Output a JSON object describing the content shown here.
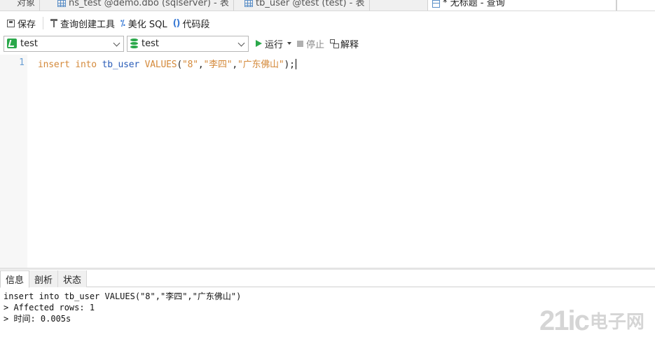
{
  "tabs": [
    {
      "label": "对象",
      "type": "plain"
    },
    {
      "label": "ns_test @demo.dbo (sqlserver) - 表",
      "type": "table"
    },
    {
      "label": "tb_user @test (test) - 表",
      "type": "table"
    },
    {
      "label": "* 无标题 - 查询",
      "type": "query",
      "active": true
    }
  ],
  "toolbar": {
    "save_label": "保存",
    "query_builder_label": "查询创建工具",
    "beautify_label": "美化 SQL",
    "snippet_label": "代码段"
  },
  "connection": {
    "value": "test"
  },
  "database": {
    "value": "test"
  },
  "run": {
    "run_label": "运行",
    "stop_label": "停止",
    "explain_label": "解释"
  },
  "editor": {
    "line_number": "1",
    "tokens": {
      "k1": "insert",
      "k2": "into",
      "table": "tb_user",
      "k3": "VALUES",
      "open": "(",
      "v1": "\"8\"",
      "c1": ",",
      "v2": "\"李四\"",
      "c2": ",",
      "v3": "\"广东佛山\"",
      "close": ");"
    }
  },
  "result_tabs": [
    "信息",
    "剖析",
    "状态"
  ],
  "output": {
    "line1": "insert into tb_user VALUES(\"8\",\"李四\",\"广东佛山\")",
    "line2": "> Affected rows: 1",
    "line3": "> 时间: 0.005s"
  },
  "watermark": {
    "latin": "21ic",
    "cjk": "电子网"
  }
}
